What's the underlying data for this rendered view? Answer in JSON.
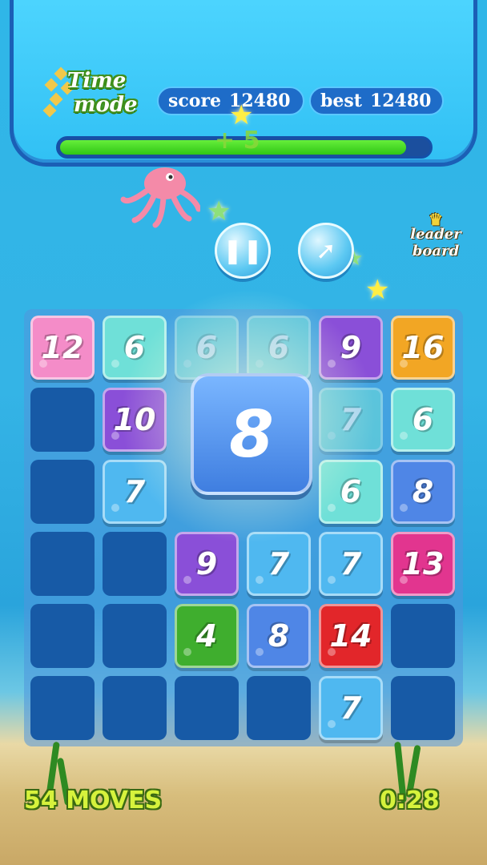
{
  "header": {
    "mode_line1": "Time",
    "mode_line2": "mode",
    "score_label": "score",
    "score_value": "12480",
    "best_label": "best",
    "best_value": "12480",
    "bonus_text": "+ 5",
    "timer_fraction": 0.94
  },
  "controls": {
    "pause_icon": "pause-icon",
    "share_icon": "share-arrow-icon",
    "leaderboard_line1": "leader",
    "leaderboard_line2": "board"
  },
  "colors": {
    "pink": "#f48cc8",
    "teal": "#6fe0d8",
    "purple": "#8a4fd8",
    "orange": "#f2a624",
    "blue": "#4f86e6",
    "magenta": "#e2358f",
    "green": "#3fae2e",
    "red": "#e2262a",
    "cyan": "#4fb8f0",
    "empty": "#175aa6"
  },
  "board": {
    "rows": [
      [
        {
          "v": "12",
          "c": "pink"
        },
        {
          "v": "6",
          "c": "teal"
        },
        {
          "v": "6",
          "c": "teal",
          "faded": true
        },
        {
          "v": "6",
          "c": "teal",
          "faded": true
        },
        {
          "v": "9",
          "c": "purple"
        },
        {
          "v": "16",
          "c": "orange"
        }
      ],
      [
        {
          "v": "",
          "c": "empty"
        },
        {
          "v": "10",
          "c": "purple"
        },
        {
          "v": "",
          "c": "none"
        },
        {
          "v": "",
          "c": "none"
        },
        {
          "v": "7",
          "c": "teal",
          "faded": true
        },
        {
          "v": "6",
          "c": "teal"
        }
      ],
      [
        {
          "v": "",
          "c": "empty"
        },
        {
          "v": "7",
          "c": "cyan"
        },
        {
          "v": "",
          "c": "none"
        },
        {
          "v": "",
          "c": "none"
        },
        {
          "v": "6",
          "c": "teal"
        },
        {
          "v": "8",
          "c": "blue"
        }
      ],
      [
        {
          "v": "",
          "c": "empty"
        },
        {
          "v": "",
          "c": "empty"
        },
        {
          "v": "9",
          "c": "purple"
        },
        {
          "v": "7",
          "c": "cyan"
        },
        {
          "v": "7",
          "c": "cyan"
        },
        {
          "v": "13",
          "c": "magenta"
        }
      ],
      [
        {
          "v": "",
          "c": "empty"
        },
        {
          "v": "",
          "c": "empty"
        },
        {
          "v": "4",
          "c": "green"
        },
        {
          "v": "8",
          "c": "blue"
        },
        {
          "v": "14",
          "c": "red"
        },
        {
          "v": "",
          "c": "empty"
        }
      ],
      [
        {
          "v": "",
          "c": "empty"
        },
        {
          "v": "",
          "c": "empty"
        },
        {
          "v": "",
          "c": "empty"
        },
        {
          "v": "",
          "c": "empty"
        },
        {
          "v": "7",
          "c": "cyan"
        },
        {
          "v": "",
          "c": "empty"
        }
      ]
    ],
    "current_tile": "8"
  },
  "footer": {
    "moves": "54 MOVES",
    "time": "0:28"
  }
}
